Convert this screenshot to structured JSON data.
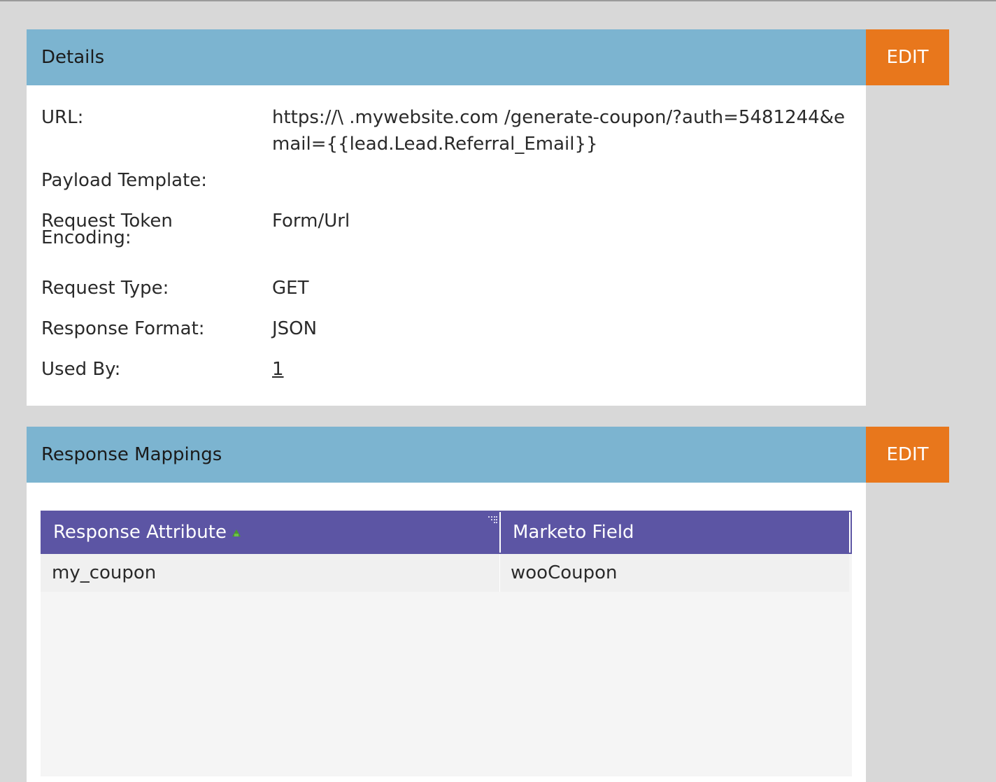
{
  "details": {
    "title": "Details",
    "edit_label": "EDIT",
    "rows": [
      {
        "label": "URL:",
        "value": "https://\\  .mywebsite.com  /generate-coupon/?auth=5481244&email={{lead.Lead.Referral_Email}}"
      },
      {
        "label": "Payload Template:",
        "value": ""
      },
      {
        "label": "Request Token Encoding:",
        "value": "Form/Url"
      },
      {
        "label": "Request Type:",
        "value": "GET"
      },
      {
        "label": "Response Format:",
        "value": "JSON"
      },
      {
        "label": "Used By:",
        "value": "1"
      }
    ]
  },
  "mappings": {
    "title": "Response Mappings",
    "edit_label": "EDIT",
    "columns": [
      "Response Attribute",
      "Marketo Field"
    ],
    "rows": [
      [
        "my_coupon",
        "wooCoupon"
      ]
    ]
  },
  "colors": {
    "header_blue": "#7cb4d0",
    "edit_orange": "#e8771c",
    "grid_header_purple": "#5c55a4",
    "sort_icon_green": "#4a9a2e"
  }
}
